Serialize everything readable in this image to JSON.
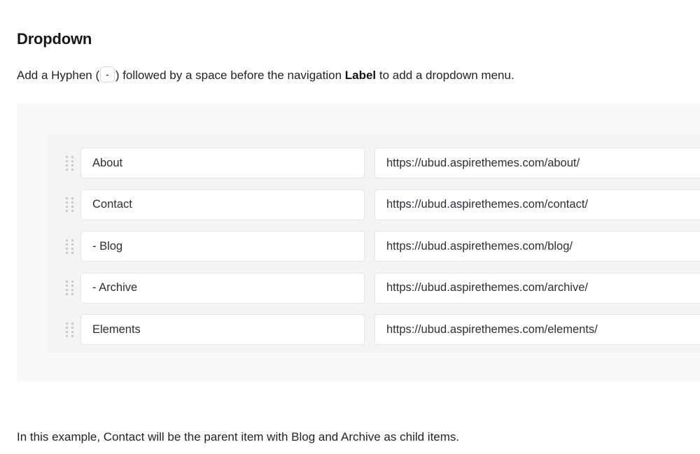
{
  "heading": "Dropdown",
  "intro": {
    "before_chip": "Add a Hyphen (",
    "chip": "-",
    "after_chip": ") followed by a space before the navigation ",
    "bold_word": "Label",
    "tail": " to add a dropdown menu."
  },
  "menu_builder": {
    "drag_handle_icon": "drag-handle-icon",
    "rows": [
      {
        "label": "About",
        "url": "https://ubud.aspirethemes.com/about/"
      },
      {
        "label": "Contact",
        "url": "https://ubud.aspirethemes.com/contact/"
      },
      {
        "label": "- Blog",
        "url": "https://ubud.aspirethemes.com/blog/"
      },
      {
        "label": "- Archive",
        "url": "https://ubud.aspirethemes.com/archive/"
      },
      {
        "label": "Elements",
        "url": "https://ubud.aspirethemes.com/elements/"
      }
    ]
  },
  "footer_note": "In this example, Contact will be the parent item with Blog and Archive as child items.",
  "colors": {
    "panel_outer_bg": "#f8f8f9",
    "panel_inner_bg": "#f4f4f5",
    "field_bg": "#ffffff",
    "field_border": "#e6e7e9",
    "dot_color": "#c6c8cc",
    "text": "#1f2228"
  }
}
